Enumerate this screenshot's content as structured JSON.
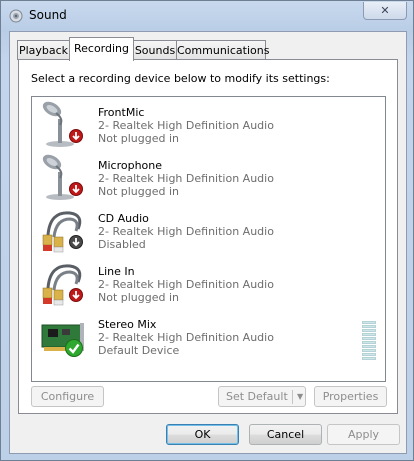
{
  "window": {
    "title": "Sound",
    "icons": {
      "app": "speaker-icon",
      "close": "close-icon"
    },
    "close_glyph": "✕"
  },
  "tabs": [
    {
      "label": "Playback",
      "active": false
    },
    {
      "label": "Recording",
      "active": true
    },
    {
      "label": "Sounds",
      "active": false
    },
    {
      "label": "Communications",
      "active": false
    }
  ],
  "recording": {
    "instruction": "Select a recording device below to modify its settings:",
    "devices": [
      {
        "name": "FrontMic",
        "description": "2- Realtek High Definition Audio",
        "status": "Not plugged in",
        "icon": "microphone-icon",
        "badge": "red-down-arrow-badge"
      },
      {
        "name": "Microphone",
        "description": "2- Realtek High Definition Audio",
        "status": "Not plugged in",
        "icon": "microphone-icon",
        "badge": "red-down-arrow-badge"
      },
      {
        "name": "CD Audio",
        "description": "2- Realtek High Definition Audio",
        "status": "Disabled",
        "icon": "rca-cable-icon",
        "badge": "gray-down-arrow-badge"
      },
      {
        "name": "Line In",
        "description": "2- Realtek High Definition Audio",
        "status": "Not plugged in",
        "icon": "rca-cable-icon",
        "badge": "red-down-arrow-badge"
      },
      {
        "name": "Stereo Mix",
        "description": "2- Realtek High Definition Audio",
        "status": "Default Device",
        "icon": "sound-card-icon",
        "badge": "green-check-badge",
        "level": 0
      }
    ],
    "buttons": {
      "configure": "Configure",
      "set_default": "Set Default",
      "set_default_arrow": "▼",
      "properties": "Properties"
    }
  },
  "footer": {
    "ok": "OK",
    "cancel": "Cancel",
    "apply": "Apply"
  },
  "colors": {
    "title_bar": "#bcd0e8",
    "badge_red": "#c01818",
    "badge_green": "#2ea82e",
    "badge_gray": "#4a4a4a",
    "disabled_text": "#8d8d8d"
  }
}
